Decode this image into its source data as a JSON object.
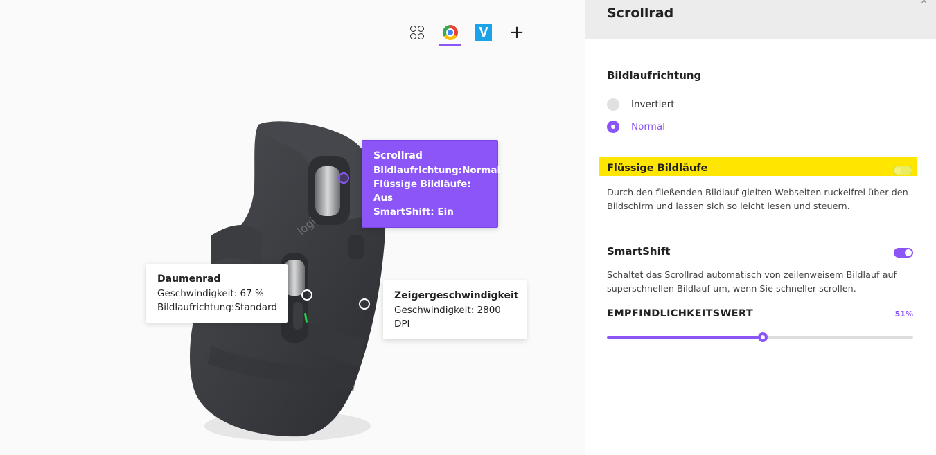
{
  "app_tabs": [
    {
      "name": "Alle Anwendungen",
      "icon": "apps-grid-icon"
    },
    {
      "name": "Google Chrome",
      "icon": "chrome-icon",
      "active": true
    },
    {
      "name": "V",
      "icon": "app-v-icon"
    },
    {
      "name": "+",
      "icon": "plus-icon"
    }
  ],
  "callouts": {
    "scroll": {
      "title": "Scrollrad",
      "lines": [
        "Bildlaufrichtung:Normal",
        "Flüssige Bildläufe: Aus",
        "SmartShift: Ein"
      ]
    },
    "thumb": {
      "title": "Daumenrad",
      "lines": [
        "Geschwindigkeit: 67 %",
        "Bildlaufrichtung:Standard"
      ]
    },
    "pointer": {
      "title": "Zeigergeschwindigkeit",
      "lines": [
        "Geschwindigkeit: 2800 DPI"
      ]
    }
  },
  "mouse": {
    "logo_text": "logi"
  },
  "panel": {
    "title": "Scrollrad",
    "window_controls": [
      "–",
      "×"
    ],
    "scroll_direction": {
      "heading": "Bildlaufrichtung",
      "options": [
        {
          "label": "Invertiert",
          "checked": false
        },
        {
          "label": "Normal",
          "checked": true
        }
      ]
    },
    "smooth_scroll": {
      "label": "Flüssige Bildläufe",
      "enabled": false,
      "description": "Durch den fließenden Bildlauf gleiten Webseiten ruckelfrei über den Bildschirm und lassen sich so leicht lesen und steuern."
    },
    "smartshift": {
      "label": "SmartShift",
      "enabled": true,
      "description": "Schaltet das Scrollrad automatisch von zeilenweisem Bildlauf auf superschnellen Bildlauf um, wenn Sie schneller scrollen.",
      "sensitivity_label": "EMPFINDLICHKEITSWERT",
      "sensitivity_value": "51%",
      "sensitivity_percent": 51
    }
  },
  "colors": {
    "accent": "#8b55f7",
    "highlight": "#ffe600",
    "mouse_body": "#3a3c40"
  }
}
